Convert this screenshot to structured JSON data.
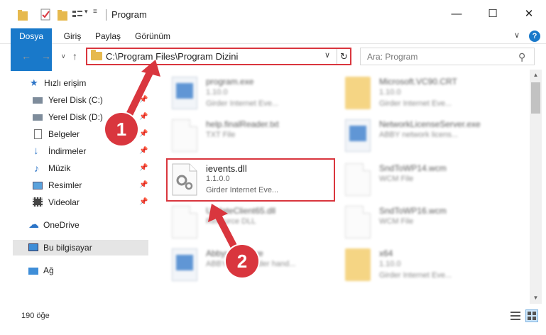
{
  "window": {
    "title": "Program",
    "minimize": "—",
    "maximize": "☐",
    "close": "✕"
  },
  "ribbon": {
    "tabs": [
      "Dosya",
      "Giriş",
      "Paylaş",
      "Görünüm"
    ]
  },
  "address": {
    "path": "C:\\Program Files\\Program Dizini"
  },
  "search": {
    "placeholder": "Ara: Program"
  },
  "sidebar": {
    "items": [
      {
        "label": "Hızlı erişim"
      },
      {
        "label": "Yerel Disk (C:)"
      },
      {
        "label": "Yerel Disk (D:)"
      },
      {
        "label": "Belgeler"
      },
      {
        "label": "İndirmeler"
      },
      {
        "label": "Müzik"
      },
      {
        "label": "Resimler"
      },
      {
        "label": "Videolar"
      },
      {
        "label": "OneDrive"
      },
      {
        "label": "Bu bilgisayar"
      },
      {
        "label": "Ağ"
      }
    ]
  },
  "files": [
    {
      "name": "program.exe",
      "line1": "1.10.0",
      "line2": "Girder Internet Eve..."
    },
    {
      "name": "Microsoft.VC90.CRT",
      "line1": "1.10.0",
      "line2": "Girder Internet Eve..."
    },
    {
      "name": "help.finalReader.txt",
      "line1": "TXT File",
      "line2": ""
    },
    {
      "name": "NetworkLicenseServer.exe",
      "line1": "ABBY network licens...",
      "line2": ""
    },
    {
      "name": "ievents.dll",
      "line1": "1.1.0.0",
      "line2": "Girder Internet Eve..."
    },
    {
      "name": "SndToWP14.wcm",
      "line1": "WCM File",
      "line2": ""
    },
    {
      "name": "UpdateClient65.dll",
      "line1": "Resource DLL",
      "line2": ""
    },
    {
      "name": "SndToWP16.wcm",
      "line1": "WCM File",
      "line2": ""
    },
    {
      "name": "AbbyyFineHive",
      "line1": "ABBY FineReader hand...",
      "line2": ""
    },
    {
      "name": "x64",
      "line1": "1.10.0",
      "line2": "Girder Internet Eve..."
    }
  ],
  "status": {
    "count": "190 öğe"
  },
  "callouts": [
    "1",
    "2"
  ],
  "colors": {
    "accent": "#1979ca",
    "highlight": "#d9363e"
  }
}
